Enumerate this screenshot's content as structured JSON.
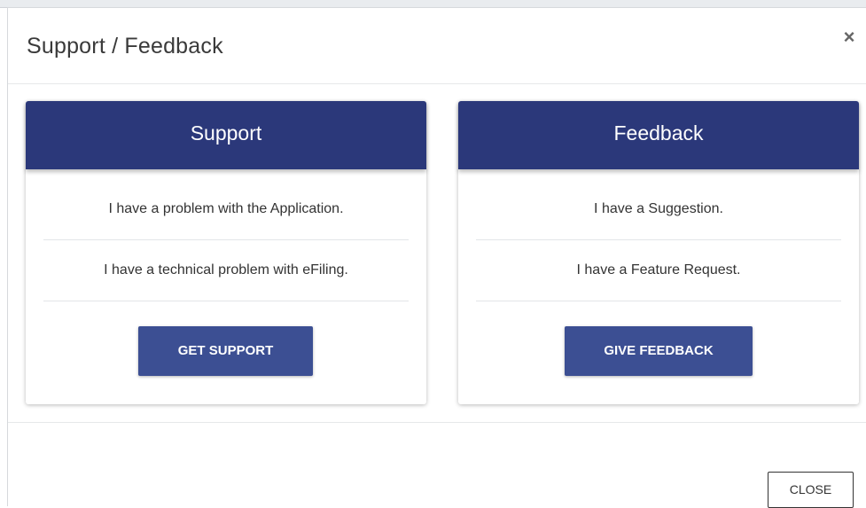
{
  "modal": {
    "title": "Support / Feedback",
    "close_icon": "×",
    "close_button_label": "CLOSE"
  },
  "cards": [
    {
      "title": "Support",
      "lines": [
        "I have a problem with the Application.",
        "I have a technical problem with eFiling."
      ],
      "button_label": "GET SUPPORT"
    },
    {
      "title": "Feedback",
      "lines": [
        "I have a Suggestion.",
        "I have a Feature Request."
      ],
      "button_label": "GIVE FEEDBACK"
    }
  ],
  "colors": {
    "card_header": "#2b387a",
    "button": "#3c4f93"
  },
  "icons": {
    "close": "close-icon"
  }
}
